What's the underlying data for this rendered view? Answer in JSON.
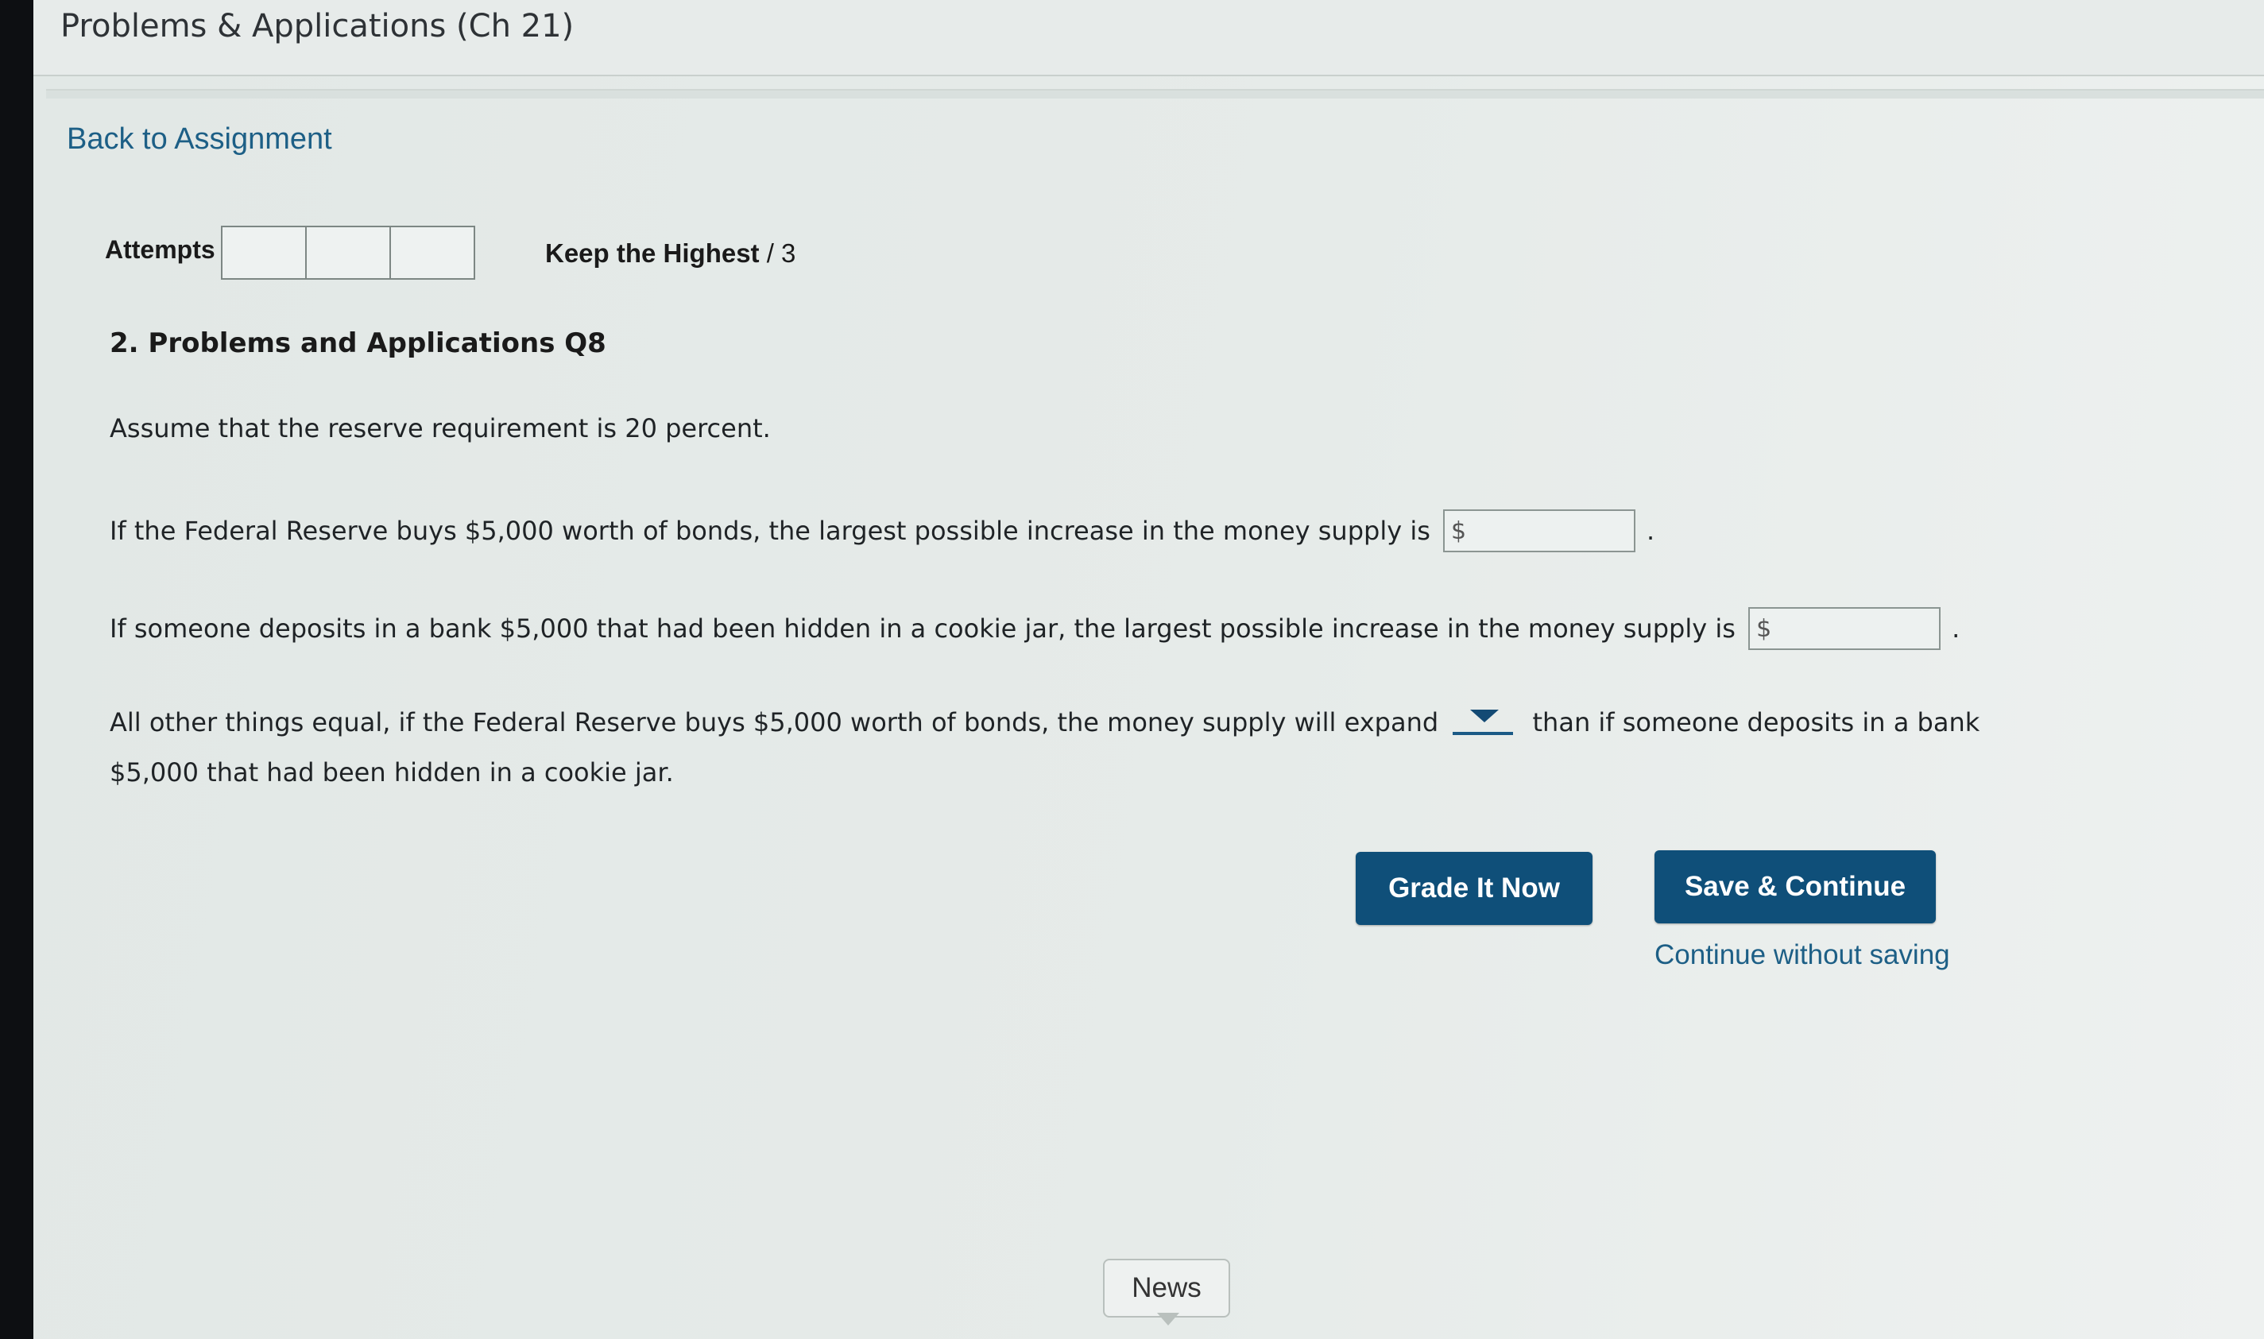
{
  "header": {
    "title": "Problems & Applications (Ch 21)"
  },
  "nav": {
    "back_link": "Back to Assignment"
  },
  "attempts": {
    "label": "Attempts",
    "box_count": 3
  },
  "grading": {
    "keep_label": "Keep the Highest",
    "suffix": " / 3"
  },
  "question": {
    "title": "2. Problems and Applications Q8",
    "intro": "Assume that the reserve requirement is 20 percent.",
    "q1_text": "If the Federal Reserve buys $5,000 worth of bonds, the largest possible increase in the money supply is",
    "q1_currency": "$",
    "q1_value": "",
    "q2_text": "If someone deposits in a bank $5,000 that had been hidden in a cookie jar, the largest possible increase in the money supply is",
    "q2_currency": "$",
    "q2_value": "",
    "q3_text_before": "All other things equal, if the Federal Reserve buys $5,000 worth of bonds, the money supply will expand",
    "q3_text_after": "than if someone deposits in a bank",
    "q3_text_line2": "$5,000 that had been hidden in a cookie jar.",
    "q3_selected": "",
    "period": "."
  },
  "actions": {
    "grade_label": "Grade It Now",
    "save_label": "Save & Continue",
    "continue_label": "Continue without saving"
  },
  "footer": {
    "news_label": "News"
  }
}
